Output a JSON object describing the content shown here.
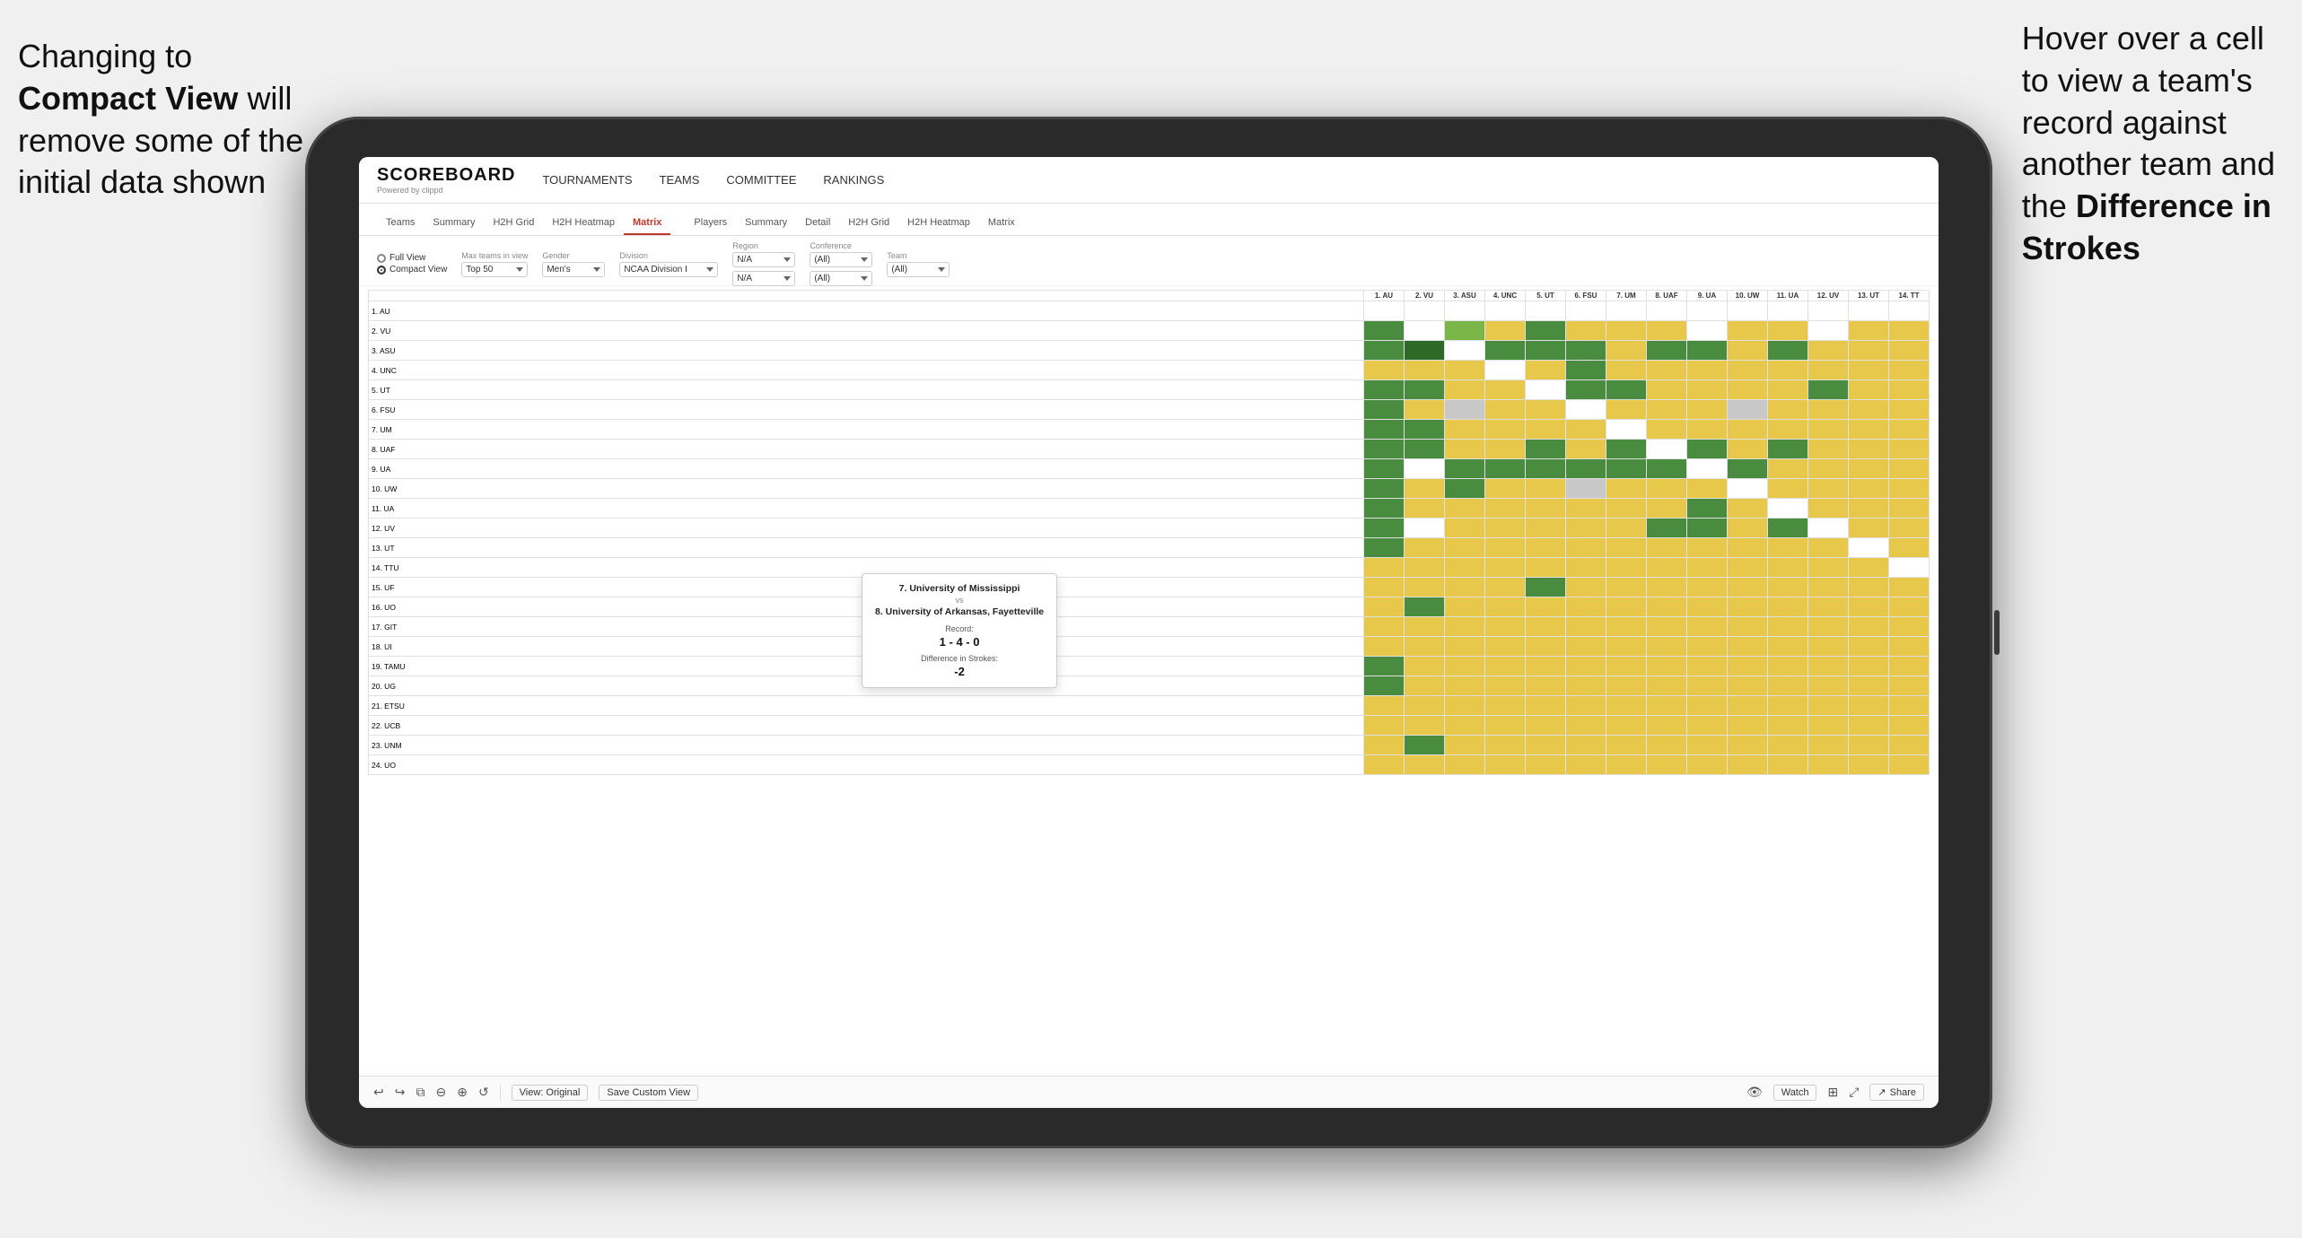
{
  "annotations": {
    "left_text_line1": "Changing to",
    "left_text_line2": "Compact View will",
    "left_text_line3": "remove some of the",
    "left_text_line4": "initial data shown",
    "right_text_line1": "Hover over a cell",
    "right_text_line2": "to view a team's",
    "right_text_line3": "record against",
    "right_text_line4": "another team and",
    "right_text_line5": "the ",
    "right_text_bold": "Difference in Strokes"
  },
  "header": {
    "logo": "SCOREBOARD",
    "logo_sub": "Powered by clippd",
    "nav": [
      "TOURNAMENTS",
      "TEAMS",
      "COMMITTEE",
      "RANKINGS"
    ]
  },
  "sub_nav": {
    "teams_tabs": [
      "Teams",
      "Summary",
      "H2H Grid",
      "H2H Heatmap",
      "Matrix"
    ],
    "players_tabs": [
      "Players",
      "Summary",
      "Detail",
      "H2H Grid",
      "H2H Heatmap",
      "Matrix"
    ],
    "active": "Matrix"
  },
  "filters": {
    "view_options": [
      "Full View",
      "Compact View"
    ],
    "selected_view": "Compact View",
    "max_teams_label": "Max teams in view",
    "max_teams_value": "Top 50",
    "gender_label": "Gender",
    "gender_value": "Men's",
    "division_label": "Division",
    "division_value": "NCAA Division I",
    "region_label": "Region",
    "region_value": "N/A",
    "conference_label": "Conference",
    "conference_values": [
      "(All)",
      "(All)"
    ],
    "team_label": "Team",
    "team_value": "(All)"
  },
  "matrix": {
    "col_headers": [
      "1. AU",
      "2. VU",
      "3. ASU",
      "4. UNC",
      "5. UT",
      "6. FSU",
      "7. UM",
      "8. UAF",
      "9. UA",
      "10. UW",
      "11. UA",
      "12. UV",
      "13. UT",
      "14. TT"
    ],
    "row_teams": [
      "1. AU",
      "2. VU",
      "3. ASU",
      "4. UNC",
      "5. UT",
      "6. FSU",
      "7. UM",
      "8. UAF",
      "9. UA",
      "10. UW",
      "11. UA",
      "12. UV",
      "13. UT",
      "14. TTU",
      "15. UF",
      "16. UO",
      "17. GIT",
      "18. UI",
      "19. TAMU",
      "20. UG",
      "21. ETSU",
      "22. UCB",
      "23. UNM",
      "24. UO"
    ]
  },
  "tooltip": {
    "team1": "7. University of Mississippi",
    "vs": "vs",
    "team2": "8. University of Arkansas, Fayetteville",
    "record_label": "Record:",
    "record_value": "1 - 4 - 0",
    "diff_label": "Difference in Strokes:",
    "diff_value": "-2"
  },
  "toolbar": {
    "view_original": "View: Original",
    "save_custom": "Save Custom View",
    "watch": "Watch",
    "share": "Share"
  }
}
